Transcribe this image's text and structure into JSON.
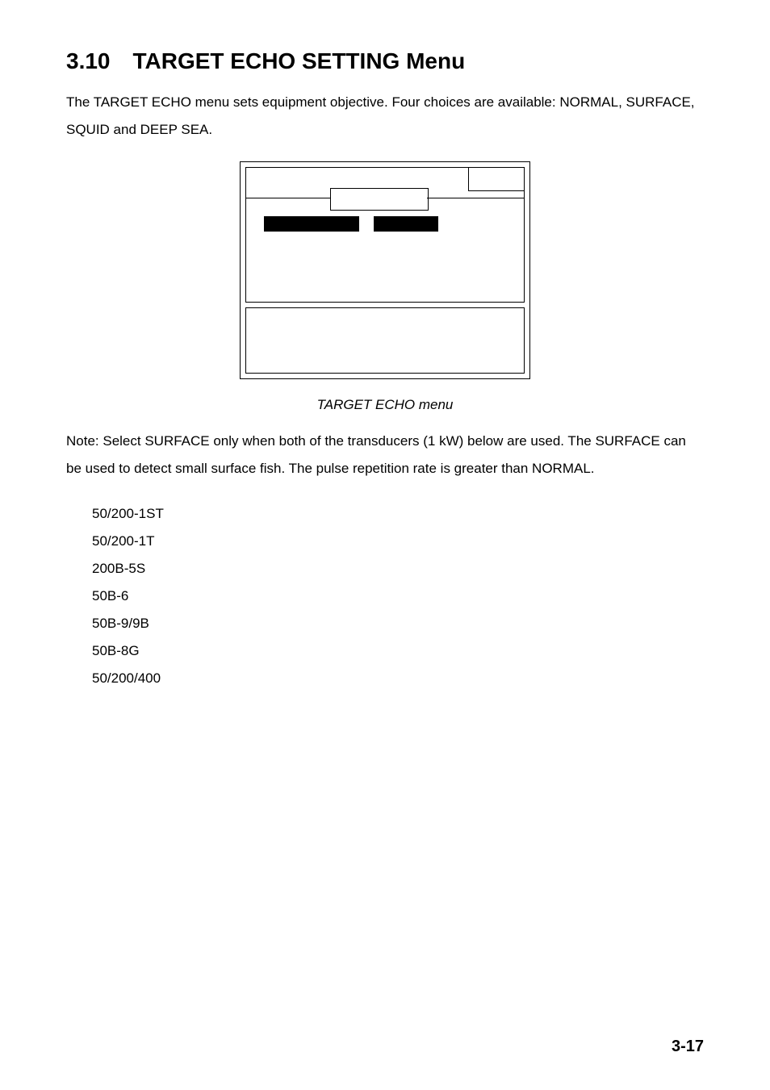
{
  "section": {
    "number": "3.10",
    "title": "TARGET ECHO SETTING Menu"
  },
  "intro_paragraph": "The TARGET ECHO menu sets equipment objective. Four choices are available: NORMAL, SURFACE, SQUID and DEEP SEA.",
  "figure_caption": "TARGET ECHO menu",
  "note_paragraph": "Note: Select SURFACE only when both of the transducers (1 kW) below are used. The SURFACE can be used to detect small surface fish. The pulse repetition rate is greater than NORMAL.",
  "transducers": [
    "50/200-1ST",
    "50/200-1T",
    "200B-5S",
    "50B-6",
    "50B-9/9B",
    "50B-8G",
    "50/200/400"
  ],
  "page_number": "3-17"
}
